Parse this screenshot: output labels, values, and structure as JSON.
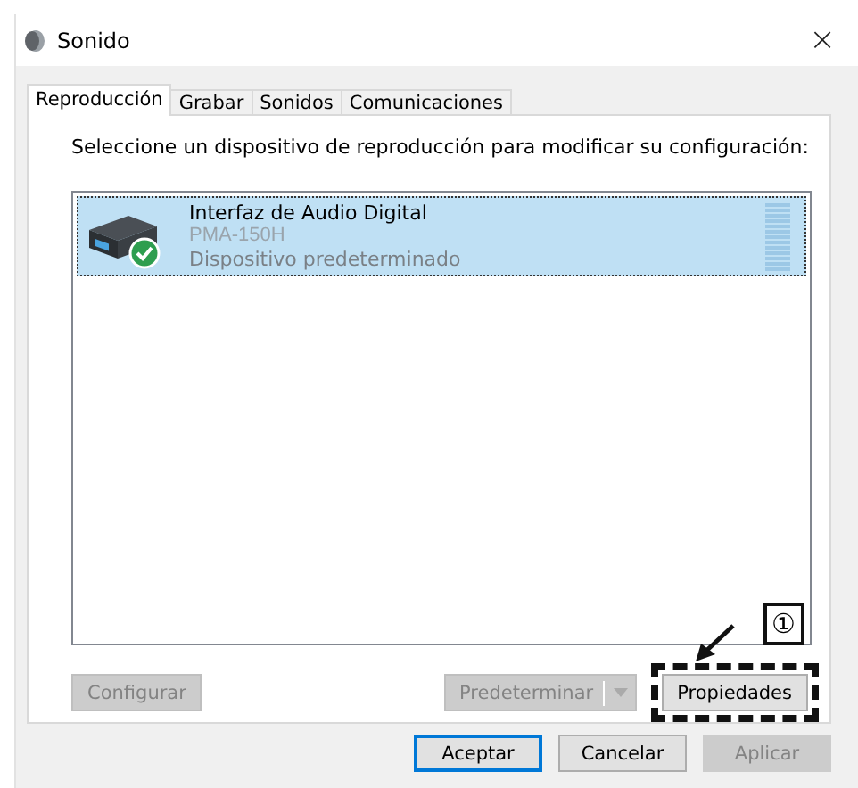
{
  "window": {
    "title": "Sonido",
    "close": "×"
  },
  "tabs": [
    {
      "label": "Reproducción",
      "selected": true
    },
    {
      "label": "Grabar",
      "selected": false
    },
    {
      "label": "Sonidos",
      "selected": false
    },
    {
      "label": "Comunicaciones",
      "selected": false
    }
  ],
  "instruction": "Seleccione un dispositivo de reproducción para modificar su configuración:",
  "devices": [
    {
      "name": "Interfaz de Audio Digital",
      "model": "PMA-150H",
      "status": "Dispositivo predeterminado",
      "selected": true,
      "default": true
    }
  ],
  "panel_buttons": [
    {
      "label": "Configurar",
      "kind": "plain",
      "disabled": true
    },
    {
      "label": "Predeterminar",
      "kind": "split",
      "disabled": true
    },
    {
      "label": "Propiedades",
      "kind": "plain",
      "disabled": false,
      "highlighted": true
    }
  ],
  "callout": {
    "label": "①"
  },
  "dialog_buttons": [
    {
      "label": "Aceptar",
      "default": true,
      "disabled": false
    },
    {
      "label": "Cancelar",
      "default": false,
      "disabled": false
    },
    {
      "label": "Aplicar",
      "default": false,
      "disabled": true
    }
  ]
}
